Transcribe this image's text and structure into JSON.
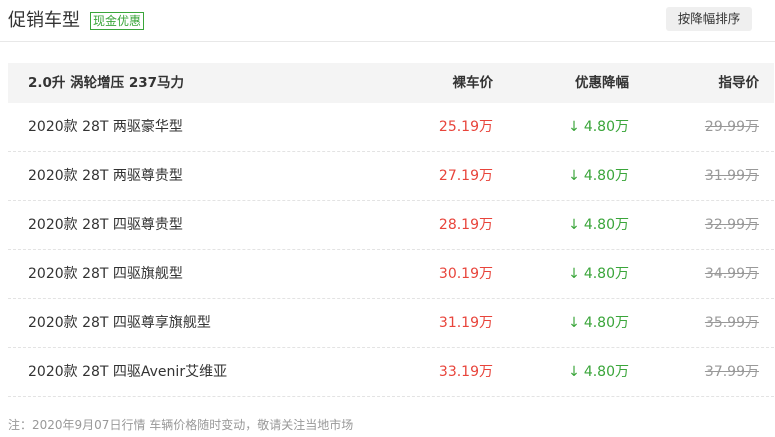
{
  "header": {
    "title": "促销车型",
    "badge": "现金优惠",
    "sort_button": "按降幅排序"
  },
  "table": {
    "columns": [
      "2.0升 涡轮增压 237马力",
      "裸车价",
      "优惠降幅",
      "指导价"
    ],
    "rows": [
      {
        "name": "2020款 28T 两驱豪华型",
        "price": "25.19万",
        "discount": "4.80万",
        "guide": "29.99万"
      },
      {
        "name": "2020款 28T 两驱尊贵型",
        "price": "27.19万",
        "discount": "4.80万",
        "guide": "31.99万"
      },
      {
        "name": "2020款 28T 四驱尊贵型",
        "price": "28.19万",
        "discount": "4.80万",
        "guide": "32.99万"
      },
      {
        "name": "2020款 28T 四驱旗舰型",
        "price": "30.19万",
        "discount": "4.80万",
        "guide": "34.99万"
      },
      {
        "name": "2020款 28T 四驱尊享旗舰型",
        "price": "31.19万",
        "discount": "4.80万",
        "guide": "35.99万"
      },
      {
        "name": "2020款 28T 四驱Avenir艾维亚",
        "price": "33.19万",
        "discount": "4.80万",
        "guide": "37.99万"
      }
    ],
    "discount_arrow": "↓"
  },
  "footer": {
    "note": "注：2020年9月07日行情 车辆价格随时变动，敬请关注当地市场"
  },
  "colors": {
    "price": "#e8443b",
    "discount": "#3aa53a",
    "guide": "#999999"
  }
}
